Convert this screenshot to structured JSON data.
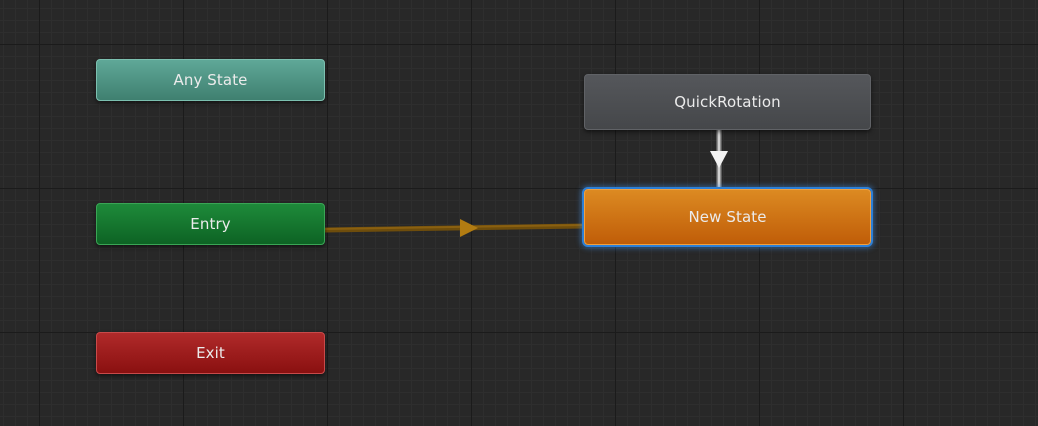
{
  "nodes": {
    "any_state": "Any State",
    "entry": "Entry",
    "exit": "Exit",
    "quick_rotation": "QuickRotation",
    "new_state": "New State"
  },
  "colors": {
    "background": "#282828",
    "any_state": "#4f9484",
    "entry": "#13742d",
    "exit": "#9c1c1c",
    "state_default": "#4d4f52",
    "state_default_highlight": "#d07420",
    "selection_outline": "#2d7fd6",
    "entry_transition": "#7a5510",
    "state_transition": "#c8c8c8"
  },
  "icons": {
    "entry_transition_arrow": "triangle-right-icon",
    "state_transition_arrow": "triangle-down-icon"
  }
}
